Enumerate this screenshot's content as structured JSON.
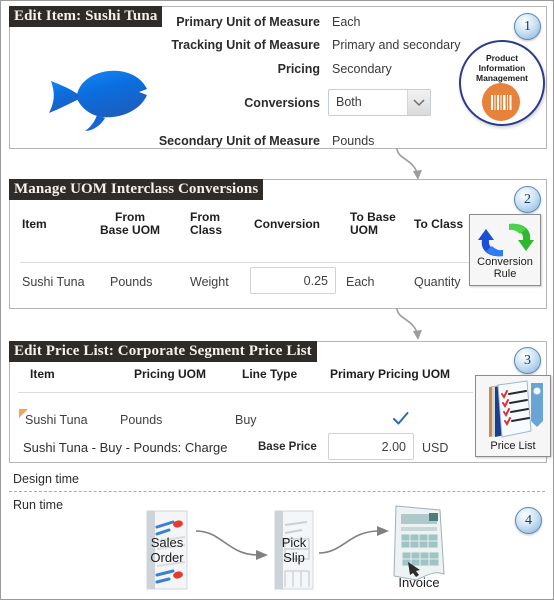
{
  "panel1": {
    "title": "Edit Item: Sushi Tuna",
    "badge": "1",
    "fields": [
      {
        "label": "Primary Unit of Measure",
        "value": "Each"
      },
      {
        "label": "Tracking Unit of Measure",
        "value": "Primary and secondary"
      },
      {
        "label": "Pricing",
        "value": "Secondary"
      },
      {
        "label": "Conversions",
        "value": "Both"
      },
      {
        "label": "Secondary Unit of Measure",
        "value": "Pounds"
      }
    ],
    "conversions_selected": "Both",
    "item_icon": "fish-icon",
    "pim_icon": {
      "line1": "Product",
      "line2": "Information",
      "line3": "Management",
      "glyph": "barcode-icon",
      "accent": "#e8813a",
      "border": "#2c3b8f"
    }
  },
  "panel2": {
    "title": "Manage UOM Interclass Conversions",
    "badge": "2",
    "columns": [
      "Item",
      "From\nBase UOM",
      "From\nClass",
      "Conversion",
      "To Base\nUOM",
      "To Class"
    ],
    "row": {
      "item": "Sushi Tuna",
      "from_base_uom": "Pounds",
      "from_class": "Weight",
      "conversion": "0.25",
      "to_base_uom": "Each",
      "to_class": "Quantity"
    },
    "icon": {
      "name": "conversion-rule-icon",
      "caption_line1": "Conversion",
      "caption_line2": "Rule"
    }
  },
  "panel3": {
    "title": "Edit Price List: Corporate Segment Price List",
    "badge": "3",
    "columns": [
      "Item",
      "Pricing UOM",
      "Line Type",
      "Primary Pricing UOM"
    ],
    "row": {
      "item": "Sushi Tuna",
      "pricing_uom": "Pounds",
      "line_type": "Buy",
      "primary_pricing_uom": "checkmark"
    },
    "charge": {
      "description": "Sushi Tuna - Buy - Pounds: Charge",
      "label": "Base Price",
      "amount": "2.00",
      "currency": "USD"
    },
    "icon": {
      "name": "price-list-icon",
      "caption": "Price List"
    }
  },
  "footer": {
    "design_time": "Design time",
    "run_time": "Run time",
    "badge": "4",
    "flow": [
      {
        "name": "sales-order-doc",
        "caption": "Sales\nOrder"
      },
      {
        "name": "pick-slip-doc",
        "caption": "Pick\nSlip"
      },
      {
        "name": "invoice-doc",
        "caption": "Invoice"
      }
    ]
  }
}
